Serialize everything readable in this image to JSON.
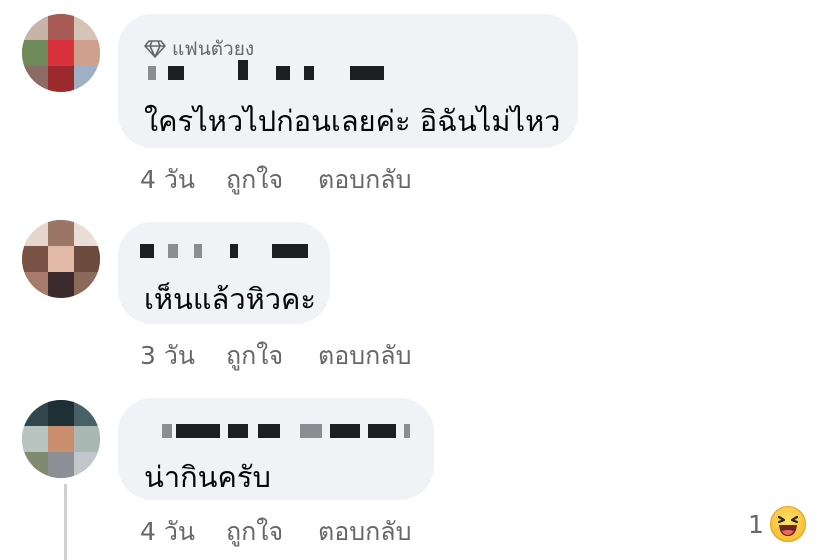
{
  "comments": [
    {
      "badge": "แฟนตัวยง",
      "text": "ใครไหวไปก่อนเลยค่ะ  อิฉันไม่ไหว",
      "time": "4 วัน",
      "like": "ถูกใจ",
      "reply": "ตอบกลับ"
    },
    {
      "text": "เห็นแล้วหิวคะ",
      "time": "3 วัน",
      "like": "ถูกใจ",
      "reply": "ตอบกลับ"
    },
    {
      "text": "น่ากินครับ",
      "time": "4 วัน",
      "like": "ถูกใจ",
      "reply": "ตอบกลับ",
      "reaction_count": "1"
    }
  ],
  "colors": {
    "bubble": "#f0f2f5",
    "secondary_text": "#65676b",
    "primary_text": "#050505"
  },
  "icons": {
    "badge": "diamond-icon",
    "reaction": "laughing-emoji-icon"
  }
}
